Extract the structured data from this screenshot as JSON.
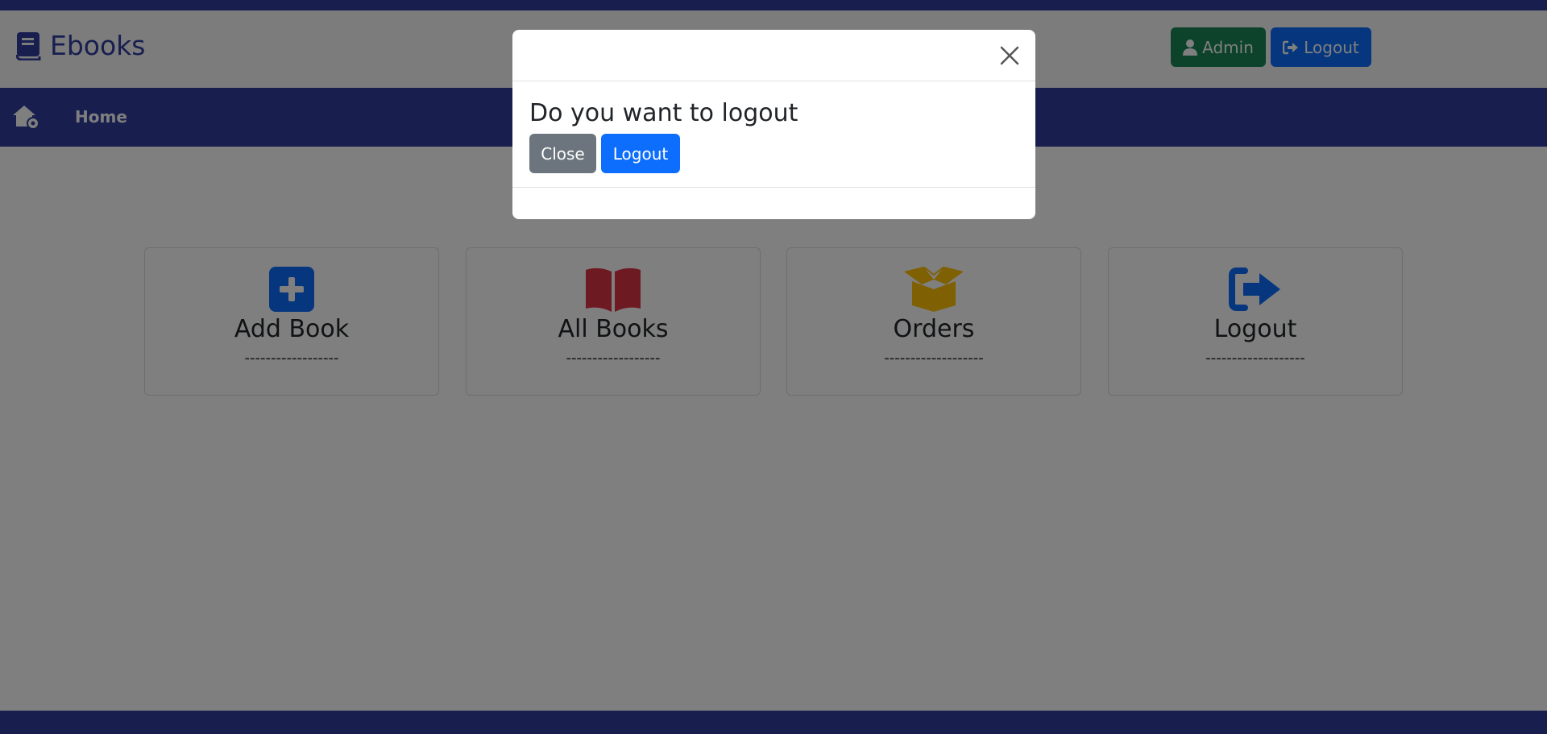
{
  "brand": {
    "name": "Ebooks",
    "icon": "book-icon"
  },
  "header": {
    "admin_label": "Admin",
    "logout_label": "Logout"
  },
  "nav": {
    "home_label": "Home",
    "home_icon": "house-icon"
  },
  "cards": [
    {
      "title": "Add Book",
      "dash": "------------------",
      "icon": "square-plus-icon",
      "color": "#0d6efd"
    },
    {
      "title": "All Books",
      "dash": "------------------",
      "icon": "book-open-icon",
      "color": "#dc3545"
    },
    {
      "title": "Orders",
      "dash": "-------------------",
      "icon": "box-open-icon",
      "color": "#ffc107"
    },
    {
      "title": "Logout",
      "dash": "-------------------",
      "icon": "right-from-bracket-icon",
      "color": "#0d6efd"
    }
  ],
  "modal": {
    "question": "Do you want to logout",
    "close_label": "Close",
    "logout_label": "Logout"
  },
  "colors": {
    "primary": "#303f9f",
    "admin": "#198754",
    "logout": "#0d6efd",
    "close": "#6c757d"
  }
}
